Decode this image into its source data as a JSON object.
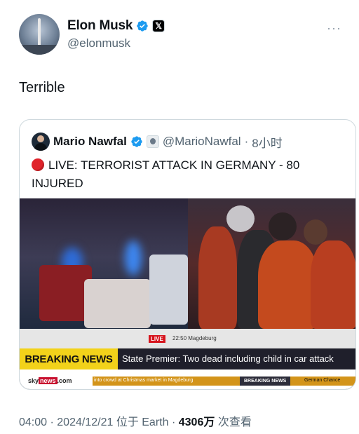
{
  "author": {
    "name": "Elon Musk",
    "handle": "@elonmusk",
    "verified_icon": "verified-badge-icon",
    "affiliation_icon": "x-logo-icon",
    "affiliation_glyph": "𝕏"
  },
  "more_menu_glyph": "···",
  "tweet": {
    "text": "Terrible"
  },
  "quoted": {
    "name": "Mario Nawfal",
    "handle": "@MarioNawfal",
    "separator": "·",
    "time": "8小时",
    "dot_icon": "red-circle-icon",
    "text": "LIVE: TERRORIST ATTACK IN GERMANY - 80 INJURED",
    "media": {
      "live_label": "LIVE",
      "live_time": "22:50",
      "live_location": "Magdeburg",
      "breaking_label": "BREAKING NEWS",
      "breaking_text": "State Premier: Two dead including child in car attack",
      "logo_sky": "sky",
      "logo_news": "news",
      "logo_com": ".com",
      "ticker_text": "into crowd at Christmas market in Magdeburg",
      "ticker_breaking": "BREAKING NEWS",
      "ticker_tail": "German Chance"
    }
  },
  "footer": {
    "time": "04:00",
    "sep1": "·",
    "date": "2024/12/21",
    "location": "位于 Earth",
    "sep2": "·",
    "views": "4306万",
    "views_label": "次查看"
  },
  "colors": {
    "verified": "#1d9bf0",
    "text_primary": "#0f1419",
    "text_secondary": "#536471",
    "breaking_yellow": "#f2d21a",
    "live_red": "#d6141d"
  }
}
